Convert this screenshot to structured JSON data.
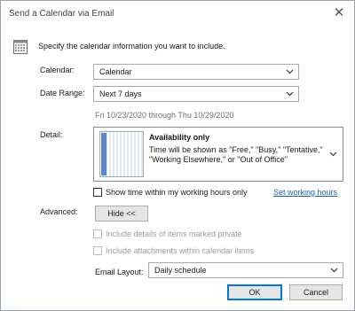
{
  "window": {
    "title": "Send a Calendar via Email",
    "close_glyph": "✕"
  },
  "intro": "Specify the calendar information you want to include.",
  "calendar": {
    "label": "Calendar:",
    "value": "Calendar"
  },
  "date_range": {
    "label": "Date Range:",
    "value": "Next 7 days",
    "range_text": "Fri 10/23/2020 through Thu 10/29/2020"
  },
  "detail": {
    "label": "Detail:",
    "title": "Availability only",
    "description": "Time will be shown as \"Free,\" \"Busy,\" \"Tentative,\" \"Working Elsewhere,\" or \"Out of Office\""
  },
  "working_hours": {
    "checkbox_label": "Show time within my working hours only",
    "checked": false,
    "link": "Set working hours"
  },
  "advanced": {
    "label": "Advanced:",
    "toggle_button": "Hide <<"
  },
  "options": {
    "private_items": "Include details of items marked private",
    "attachments": "Include attachments within calendar items"
  },
  "email_layout": {
    "label": "Email Layout:",
    "value": "Daily schedule"
  },
  "buttons": {
    "ok": "OK",
    "cancel": "Cancel"
  },
  "colors": {
    "accent": "#0078d7",
    "link": "#1b5fb5",
    "disabled_text": "#9c9c9c"
  },
  "icons": [
    "calendar-icon",
    "close-icon",
    "chevron-down-icon"
  ]
}
